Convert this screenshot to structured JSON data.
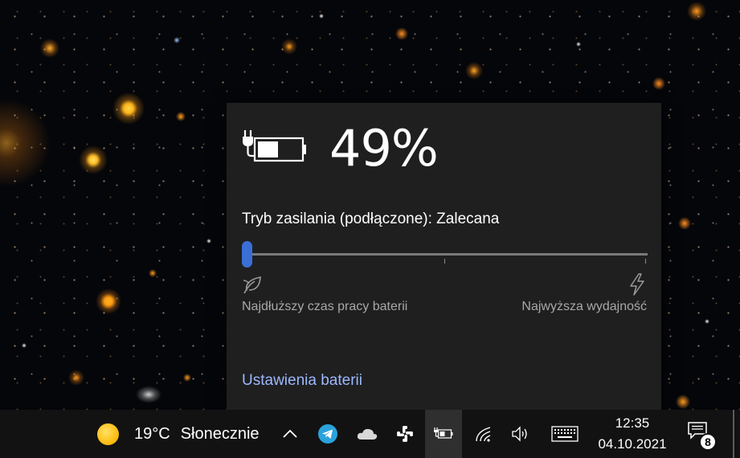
{
  "battery_flyout": {
    "percent_text": "49%",
    "charge_level": 0.49,
    "power_mode_label": "Tryb zasilania (podłączone): Zalecana",
    "slider_position": 0,
    "left_label": "Najdłuższy czas pracy baterii",
    "right_label": "Najwyższa wydajność",
    "settings_link": "Ustawienia baterii",
    "accent_color": "#3a6fd6",
    "link_color": "#9cb8ff"
  },
  "taskbar": {
    "weather": {
      "icon": "sun-icon",
      "temperature": "19°C",
      "description": "Słonecznie"
    },
    "tray_icons": [
      "chevron-up-icon",
      "telegram-icon",
      "cloud-icon",
      "slack-icon",
      "battery-plugged-icon",
      "wifi-icon",
      "volume-icon",
      "keyboard-icon"
    ],
    "clock": {
      "time": "12:35",
      "date": "04.10.2021"
    },
    "notifications": {
      "icon": "chat-icon",
      "count": "8"
    }
  }
}
